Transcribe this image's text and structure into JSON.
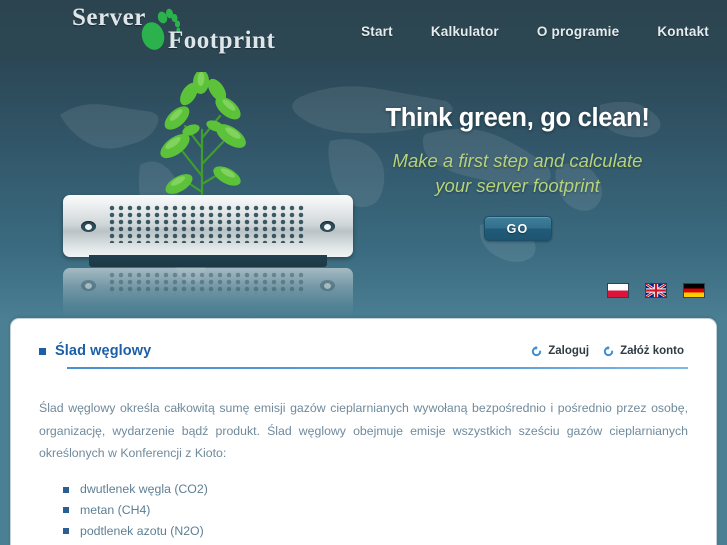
{
  "header": {
    "logo": {
      "line1": "Server",
      "line2": "Footprint",
      "icon": "footprint-icon",
      "icon_color": "#2bb24c"
    },
    "nav": [
      {
        "label": "Start"
      },
      {
        "label": "Kalkulator"
      },
      {
        "label": "O programie"
      },
      {
        "label": "Kontakt"
      }
    ]
  },
  "hero": {
    "title": "Think green, go clean!",
    "subtitle": "Make a first step and calculate your server footprint",
    "subtitle_line1": "Make a first step and calculate",
    "subtitle_line2": "your server footprint",
    "cta_label": "GO",
    "illustration": "server-with-plant",
    "title_color": "#ffffff",
    "subtitle_color": "#b6d37c",
    "cta_color": "#2f6e8b"
  },
  "language_flags": [
    {
      "name": "flag-poland-icon",
      "code": "pl"
    },
    {
      "name": "flag-united-kingdom-icon",
      "code": "gb"
    },
    {
      "name": "flag-germany-icon",
      "code": "de"
    }
  ],
  "panel": {
    "section_title": "Ślad węglowy",
    "section_title_color": "#1c5fa8",
    "account_links": [
      {
        "label": "Zaloguj",
        "icon": "refresh-arrow-icon"
      },
      {
        "label": "Załóż konto",
        "icon": "refresh-arrow-icon"
      }
    ],
    "paragraph": "Ślad węglowy określa całkowitą sumę emisji gazów cieplarnianych wywołaną bezpośrednio i pośrednio przez osobę, organizację, wydarzenie bądź produkt. Ślad węglowy obejmuje emisje wszystkich sześciu gazów cieplarnianych określonych w Konferencji z Kioto:",
    "gas_list": [
      {
        "label": "dwutlenek węgla (CO2)"
      },
      {
        "label": "metan (CH4)"
      },
      {
        "label": "podtlenek azotu (N2O)"
      }
    ]
  }
}
